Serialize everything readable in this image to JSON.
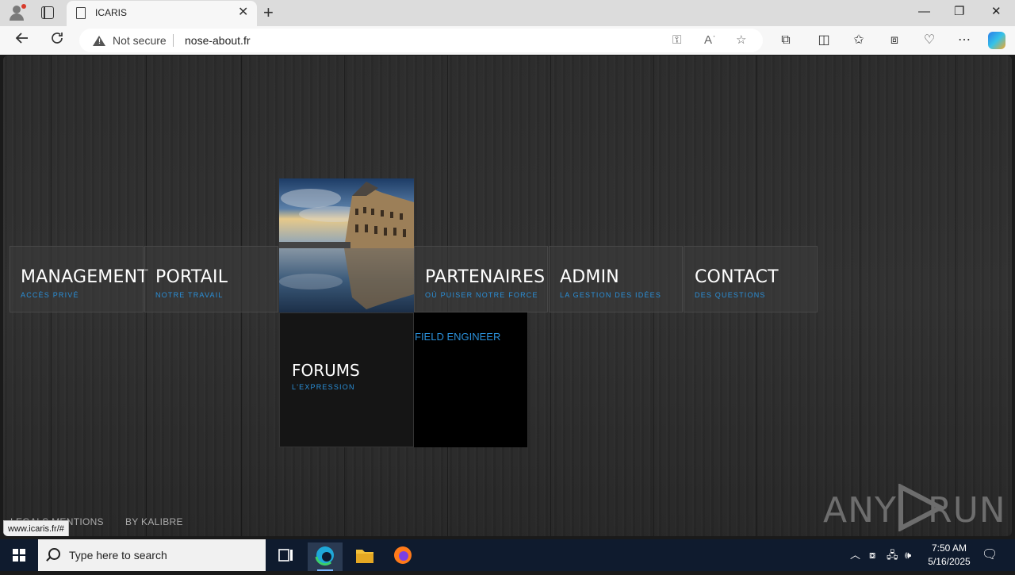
{
  "browser": {
    "tab_title": "ICARIS",
    "tab_close": "✕",
    "new_tab": "+",
    "security_label": "Not secure",
    "url": "nose-about.fr",
    "window_controls": {
      "minimize": "—",
      "restore": "❐",
      "close": "✕"
    }
  },
  "page": {
    "tiles": [
      {
        "title": "MANAGEMENT",
        "subtitle": "Accès privé"
      },
      {
        "title": "PORTAIL",
        "subtitle": "Notre travail"
      },
      {
        "title": "PARTENAIRES",
        "subtitle": "Où puiser notre force"
      },
      {
        "title": "ADMIN",
        "subtitle": "La gestion des idées"
      },
      {
        "title": "CONTACT",
        "subtitle": "Des questions"
      }
    ],
    "forums": {
      "title": "FORUMS",
      "subtitle": "L'EXPRESSION"
    },
    "field_engineer": "FIELD ENGINEER",
    "footer": {
      "legal": "LEGALS MENTIONS",
      "by": "BY KALIBRE"
    },
    "status_url": "www.icaris.fr/#",
    "watermark": {
      "left": "ANY",
      "right": "RUN"
    }
  },
  "taskbar": {
    "search_placeholder": "Type here to search",
    "time": "7:50 AM",
    "date": "5/16/2025"
  },
  "colors": {
    "accent": "#2a8fd8",
    "taskbar": "#0f1b2e",
    "chrome": "#f7f7f7"
  }
}
